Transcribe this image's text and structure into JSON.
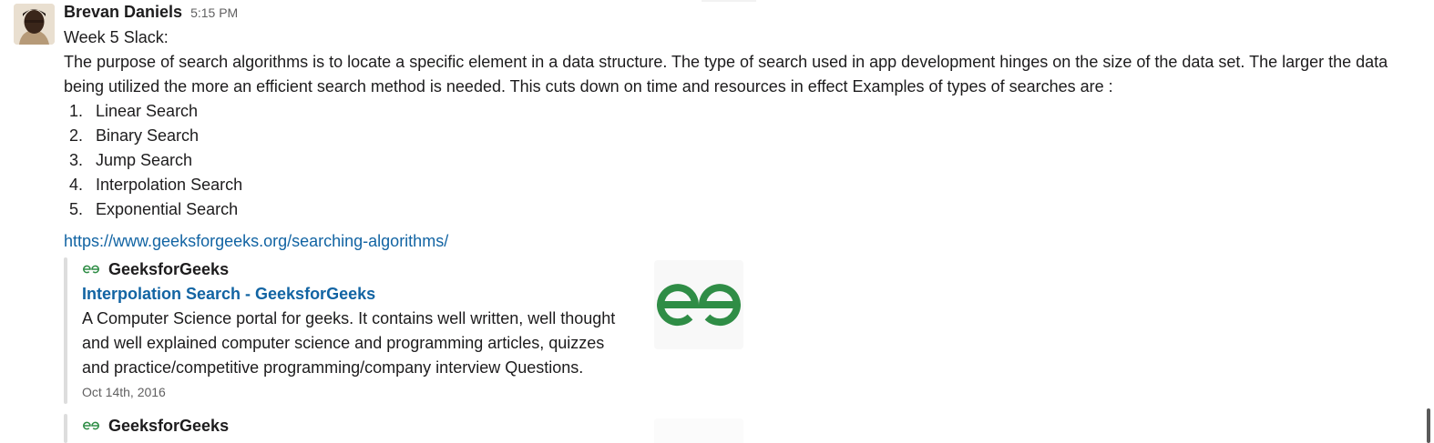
{
  "message": {
    "sender": "Brevan Daniels",
    "time": "5:15 PM",
    "lines": [
      "Week 5 Slack:",
      "The purpose of search algorithms is to locate a specific element in a data structure. The type of search used in app development hinges on the size of the data set. The larger the data",
      "being utilized the more an efficient search method is needed. This cuts down on time and resources in effect Examples of types of searches are :"
    ],
    "list": [
      {
        "num": "1.",
        "text": "Linear Search"
      },
      {
        "num": "2.",
        "text": "Binary Search"
      },
      {
        "num": "3.",
        "text": "Jump Search"
      },
      {
        "num": "4.",
        "text": "Interpolation Search"
      },
      {
        "num": "5.",
        "text": "Exponential Search"
      }
    ],
    "link": "https://www.geeksforgeeks.org/searching-algorithms/"
  },
  "attachments": [
    {
      "service": "GeeksforGeeks",
      "title": "Interpolation Search - GeeksforGeeks",
      "description_lines": [
        "A Computer Science portal for geeks. It contains well written, well thought",
        "and well explained computer science and programming articles, quizzes",
        "and practice/competitive programming/company interview Questions."
      ],
      "date": "Oct 14th, 2016",
      "thumbnail_icon": "geeksforgeeks-logo-icon"
    },
    {
      "service": "GeeksforGeeks"
    }
  ],
  "colors": {
    "link": "#1264a3",
    "text": "#1d1c1d",
    "muted": "#616061",
    "logo": "#2f8d46",
    "attachment_bar": "#dddddd"
  }
}
